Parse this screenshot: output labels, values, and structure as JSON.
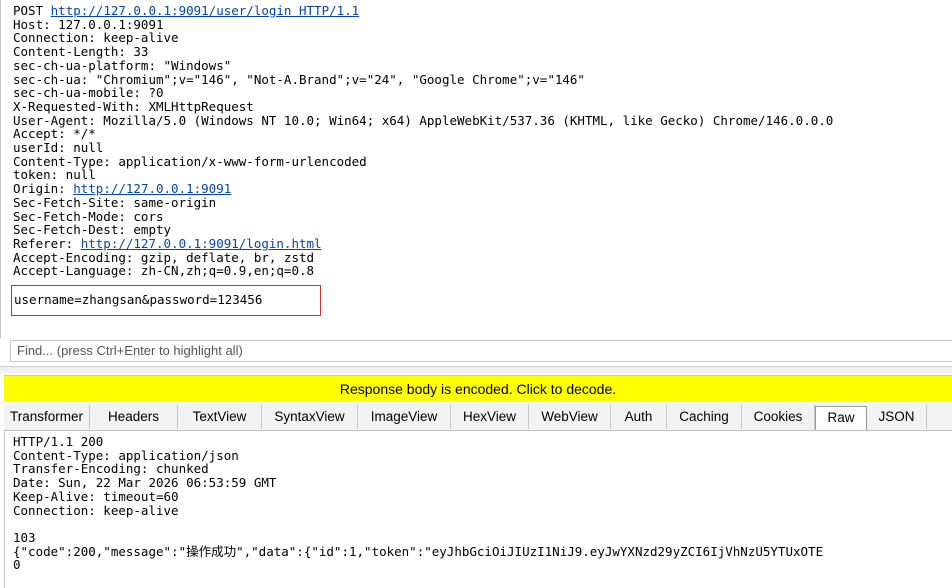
{
  "request": {
    "line1": {
      "method": "POST ",
      "url": "http://127.0.0.1:9091/user/login HTTP/1.1"
    },
    "host": "Host: 127.0.0.1:9091",
    "connection": "Connection: keep-alive",
    "content_length": "Content-Length: 33",
    "platform": "sec-ch-ua-platform: \"Windows\"",
    "ua_brands": "sec-ch-ua: \"Chromium\";v=\"146\", \"Not-A.Brand\";v=\"24\", \"Google Chrome\";v=\"146\"",
    "mobile": "sec-ch-ua-mobile: ?0",
    "xrw": "X-Requested-With: XMLHttpRequest",
    "user_agent": "User-Agent: Mozilla/5.0 (Windows NT 10.0; Win64; x64) AppleWebKit/537.36 (KHTML, like Gecko) Chrome/146.0.0.0",
    "accept": "Accept: */*",
    "userid": "userId: null",
    "content_type": "Content-Type: application/x-www-form-urlencoded",
    "token": "token: null",
    "origin": {
      "label": "Origin: ",
      "url": "http://127.0.0.1:9091"
    },
    "fetch_site": "Sec-Fetch-Site: same-origin",
    "fetch_mode": "Sec-Fetch-Mode: cors",
    "fetch_dest": "Sec-Fetch-Dest: empty",
    "referer": {
      "label": "Referer: ",
      "url": "http://127.0.0.1:9091/login.html"
    },
    "accept_encoding": "Accept-Encoding: gzip, deflate, br, zstd",
    "accept_language": "Accept-Language: zh-CN,zh;q=0.9,en;q=0.8",
    "body": "username=zhangsan&password=123456"
  },
  "find": {
    "placeholder": "Find... (press Ctrl+Enter to highlight all)"
  },
  "notice": "Response body is encoded. Click to decode.",
  "tabs": [
    {
      "label": "Transformer",
      "w": 86
    },
    {
      "label": "Headers",
      "w": 88
    },
    {
      "label": "TextView",
      "w": 84
    },
    {
      "label": "SyntaxView",
      "w": 96
    },
    {
      "label": "ImageView",
      "w": 93
    },
    {
      "label": "HexView",
      "w": 78
    },
    {
      "label": "WebView",
      "w": 82
    },
    {
      "label": "Auth",
      "w": 56
    },
    {
      "label": "Caching",
      "w": 75
    },
    {
      "label": "Cookies",
      "w": 73
    },
    {
      "label": "Raw",
      "w": 52
    },
    {
      "label": "JSON",
      "w": 60
    }
  ],
  "active_tab": "Raw",
  "response": {
    "status": "HTTP/1.1 200",
    "content_type": "Content-Type: application/json",
    "transfer": "Transfer-Encoding: chunked",
    "date": "Date: Sun, 22 Mar 2026 06:53:59 GMT",
    "keep_alive": "Keep-Alive: timeout=60",
    "connection": "Connection: keep-alive",
    "blank": "",
    "chunk_size": "103",
    "json_line": "{\"code\":200,\"message\":\"操作成功\",\"data\":{\"id\":1,\"token\":\"eyJhbGciOiJIUzI1NiJ9.eyJwYXNzd29yZCI6IjVhNzU5YTUxOTE",
    "zero": "0"
  }
}
